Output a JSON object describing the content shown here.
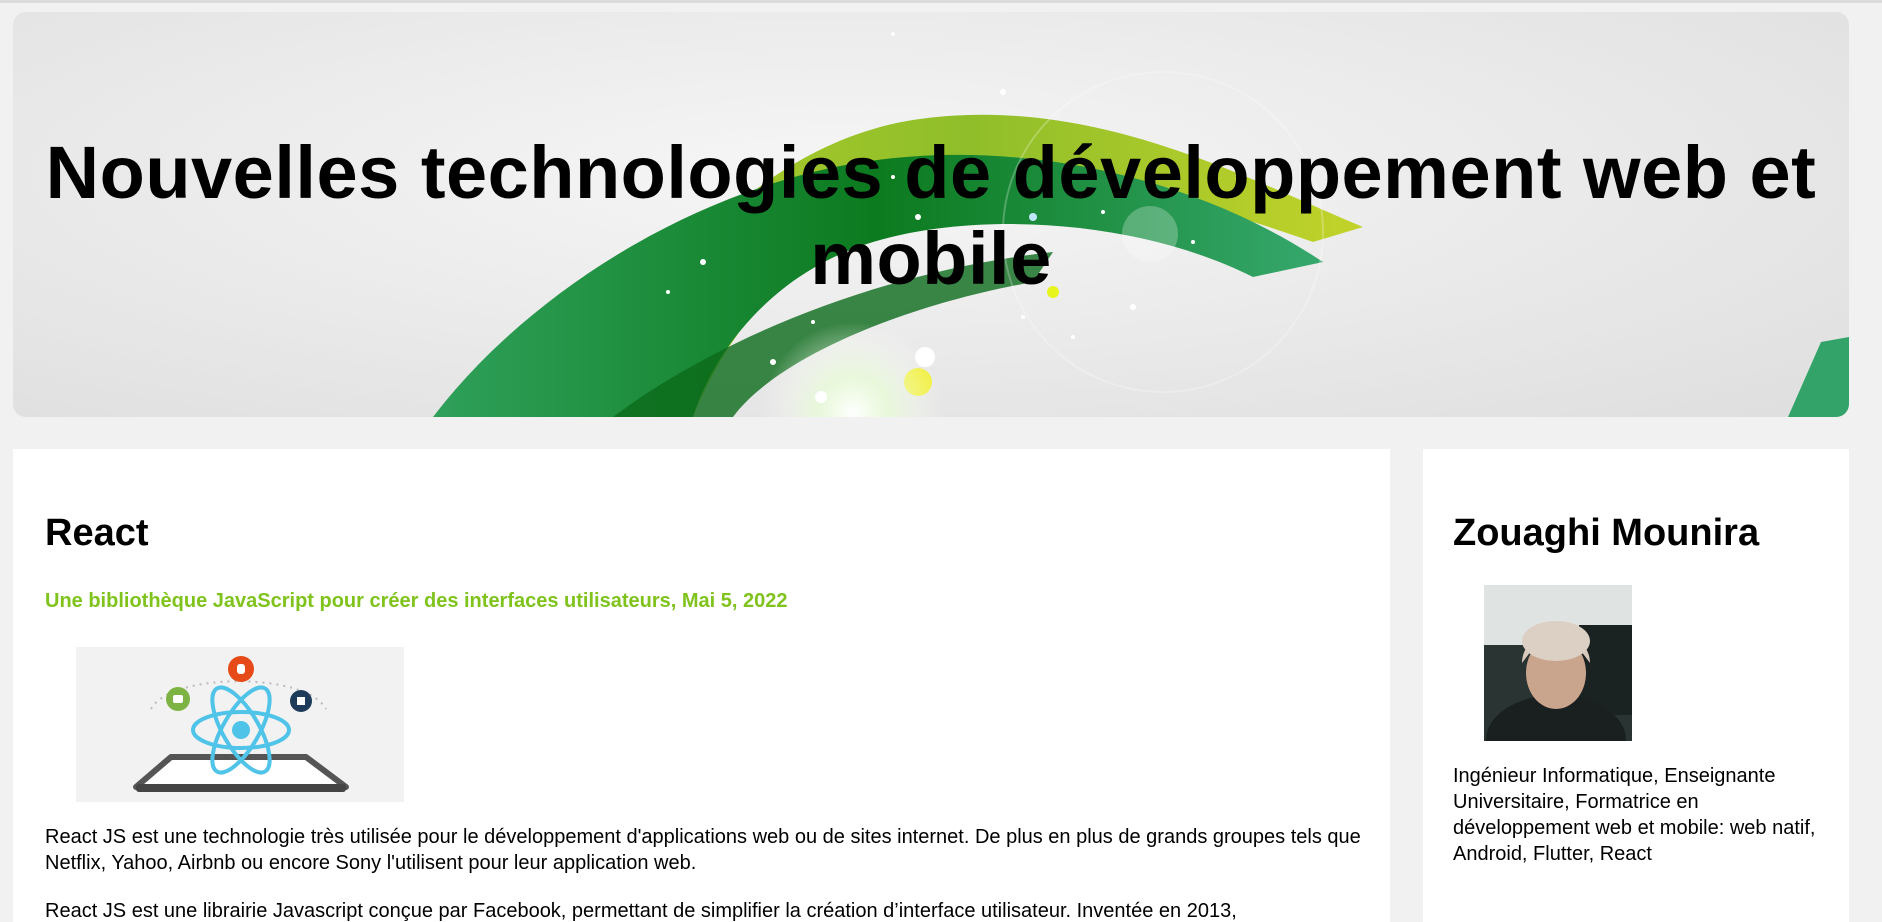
{
  "header": {
    "title": "Nouvelles technologies de développement web et mobile"
  },
  "post": {
    "title": "React",
    "subtitle": "Une bibliothèque JavaScript pour créer des interfaces utilisateurs, Mai 5, 2022",
    "image_icon": "react-atom-mobile-icon",
    "paragraphs": [
      "React JS est une technologie très utilisée pour le développement d'applications web ou de sites internet. De plus en plus de grands groupes tels que Netflix, Yahoo, Airbnb ou encore Sony l'utilisent pour leur application web.",
      "React JS est une librairie Javascript conçue par Facebook, permettant de simplifier la création d’interface utilisateur. Inventée en 2013,"
    ]
  },
  "sidebar": {
    "name": "Zouaghi Mounira",
    "bio": "Ingénieur Informatique, Enseignante Universitaire, Formatrice en développement web et mobile: web natif, Android, Flutter, React"
  },
  "colors": {
    "background": "#f1f1f1",
    "card": "#ffffff",
    "accent_green": "#7fc31c",
    "text": "#000000"
  }
}
